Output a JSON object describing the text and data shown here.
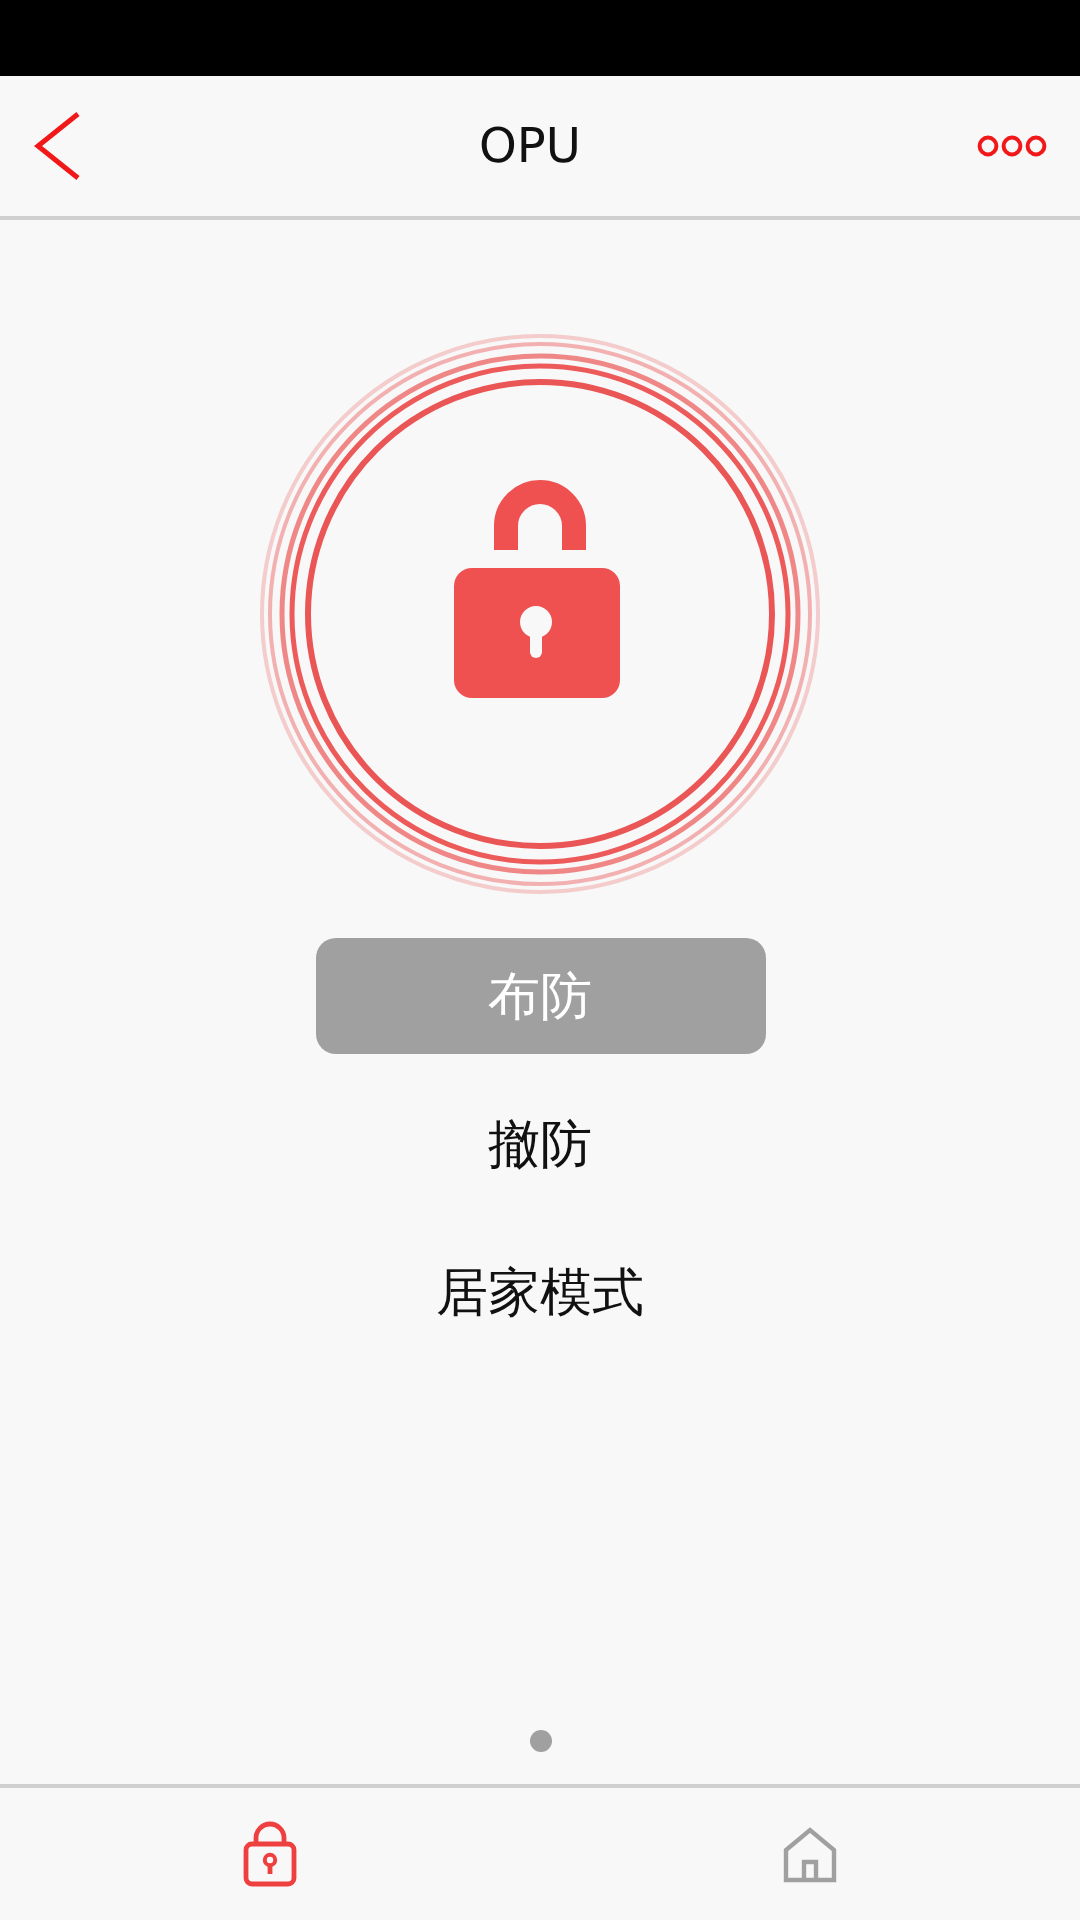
{
  "header": {
    "title": "OPU"
  },
  "modes": [
    {
      "label": "布防",
      "selected": true
    },
    {
      "label": "撤防",
      "selected": false
    },
    {
      "label": "居家模式",
      "selected": false
    }
  ],
  "page_dots": [
    {
      "selected": true
    }
  ],
  "tabs": [
    {
      "kind": "lock",
      "selected": true
    },
    {
      "kind": "home",
      "selected": false
    }
  ]
}
